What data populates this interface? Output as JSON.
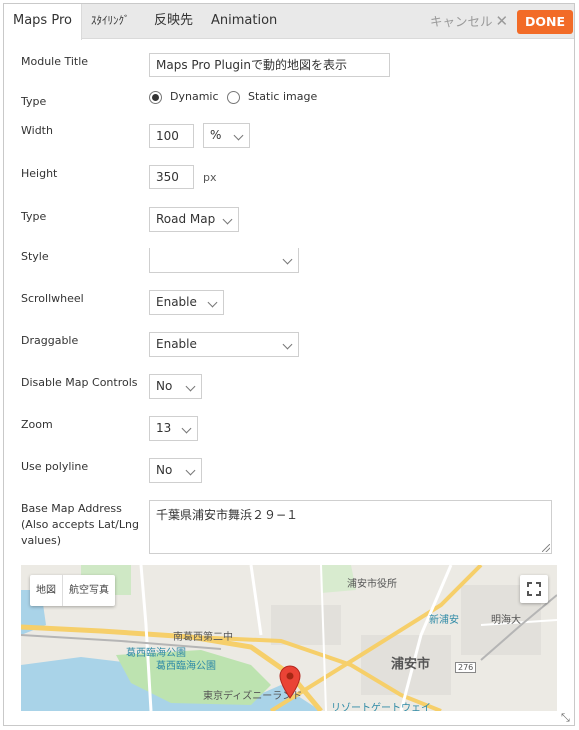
{
  "tabs": [
    {
      "label": "Maps Pro"
    },
    {
      "label": "ｽﾀｲﾘﾝｸﾞ"
    },
    {
      "label": "反映先"
    },
    {
      "label": "Animation"
    }
  ],
  "actions": {
    "cancel_label": "キャンセル",
    "done_label": "DONE"
  },
  "form": {
    "module_title": {
      "label": "Module Title",
      "value": "Maps Pro Pluginで動的地図を表示"
    },
    "type": {
      "label": "Type",
      "options": [
        "Dynamic",
        "Static image"
      ],
      "selected": "Dynamic"
    },
    "width": {
      "label": "Width",
      "value": "100",
      "unit": "%"
    },
    "height": {
      "label": "Height",
      "value": "350",
      "unit": "px"
    },
    "map_type": {
      "label": "Type",
      "value": "Road Map"
    },
    "style": {
      "label": "Style",
      "value": ""
    },
    "scrollwheel": {
      "label": "Scrollwheel",
      "value": "Enable"
    },
    "draggable": {
      "label": "Draggable",
      "value": "Enable"
    },
    "disable_map_controls": {
      "label": "Disable Map Controls",
      "value": "No"
    },
    "zoom": {
      "label": "Zoom",
      "value": "13"
    },
    "use_polyline": {
      "label": "Use polyline",
      "value": "No"
    },
    "base_map_address": {
      "label_lines": [
        "Base Map Address",
        "(Also accepts Lat/Lng",
        "values)"
      ],
      "value": "千葉県浦安市舞浜２９−１"
    }
  },
  "map": {
    "map_type_buttons": [
      "地図",
      "航空写真"
    ],
    "labels": [
      "浦安市役所",
      "新浦安",
      "明海大",
      "南葛西第二中",
      "葛西臨海公園",
      "葛西臨海公園",
      "浦安市",
      "276",
      "東京ディズニーランド",
      "リゾートゲートウェイ"
    ],
    "colors": {
      "road_major": "#f6cf6a",
      "water": "#a9d3e8",
      "park": "#bde3b0",
      "marker": "#ea4335"
    }
  }
}
